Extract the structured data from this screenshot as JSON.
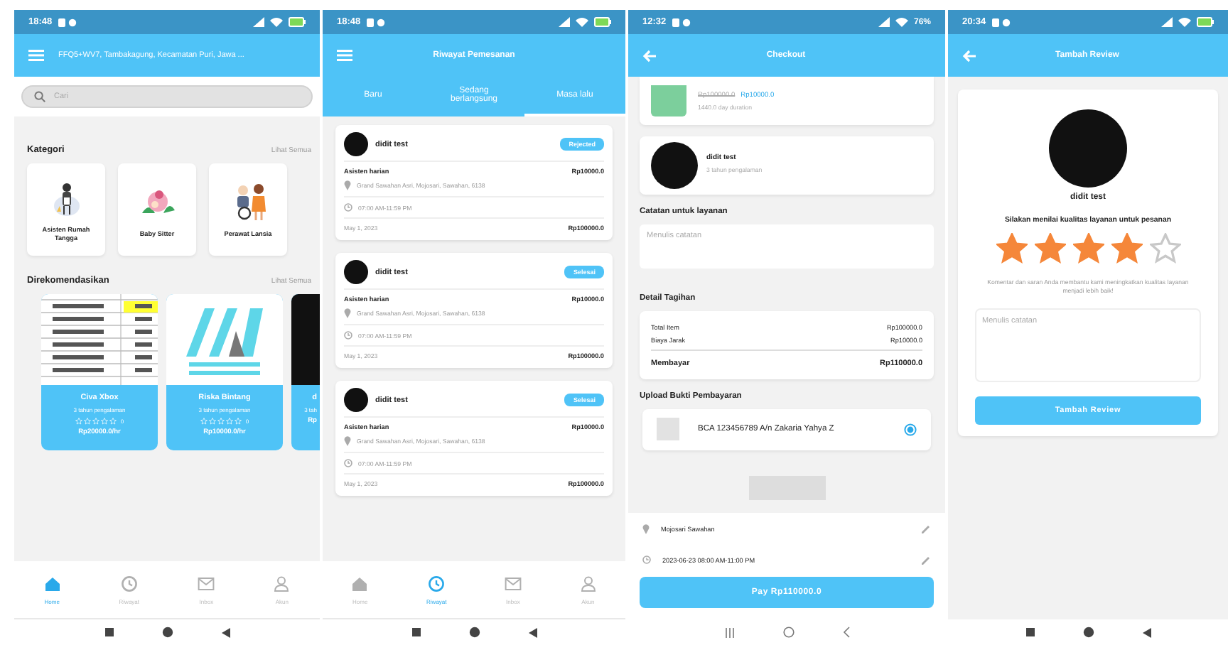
{
  "screens": [
    {
      "kind": "home",
      "system_nav": {
        "kind": "stock"
      },
      "status_bar": {
        "time": "18:48"
      },
      "location": "FFQ5+WV7, Tambakagung, Kecamatan Puri, Jawa ...",
      "search": {
        "placeholder": "Cari"
      },
      "categories": {
        "title": "Kategori",
        "link": "Lihat Semua",
        "items": [
          {
            "kind": "maid",
            "label": "Asisten Rumah Tangga"
          },
          {
            "kind": "baby",
            "label": "Baby Sitter"
          },
          {
            "kind": "elder",
            "label": "Perawat Lansia"
          }
        ]
      },
      "recommended": {
        "title": "Direkomendasikan",
        "link": "Lihat Semua",
        "items": [
          {
            "kind": "spreadsheet",
            "name": "Civa Xbox",
            "experience": "3 tahun pengalaman",
            "stars": 0,
            "rating": "0",
            "price": "Rp20000.0/hr"
          },
          {
            "kind": "logo",
            "name": "Riska Bintang",
            "experience": "3 tahun pengalaman",
            "stars": 0,
            "rating": "0",
            "price": "Rp10000.0/hr"
          },
          {
            "kind": "code",
            "name": "d",
            "experience": "3 tah",
            "price": "Rp"
          }
        ]
      },
      "nav": [
        {
          "kind": "home",
          "label": "Home",
          "selected": true
        },
        {
          "kind": "history",
          "label": "Riwayat",
          "selected": false
        },
        {
          "kind": "mail",
          "label": "Inbox",
          "selected": false
        },
        {
          "kind": "person",
          "label": "Akun",
          "selected": false
        }
      ]
    },
    {
      "kind": "orders",
      "system_nav": {
        "kind": "stock"
      },
      "status_bar": {
        "time": "18:48"
      },
      "title": "Riwayat Pemesanan",
      "tabs": [
        {
          "label": "Baru",
          "selected": false
        },
        {
          "label": "Sedang berlangsung",
          "selected": false
        },
        {
          "label": "Masa lalu",
          "selected": true
        }
      ],
      "orders": [
        {
          "name": "didit test",
          "status": "Rejected",
          "service": "Asisten harian",
          "price": "Rp10000.0",
          "address": "Grand Sawahan Asri, Mojosari, Sawahan, 6138",
          "time": "07:00 AM-11:59 PM",
          "date": "May 1, 2023",
          "total": "Rp100000.0"
        },
        {
          "name": "didit test",
          "status": "Selesai",
          "service": "Asisten harian",
          "price": "Rp10000.0",
          "address": "Grand Sawahan Asri, Mojosari, Sawahan, 6138",
          "time": "07:00 AM-11:59 PM",
          "date": "May 1, 2023",
          "total": "Rp100000.0"
        },
        {
          "name": "didit test",
          "status": "Selesai",
          "service": "Asisten harian",
          "price": "Rp10000.0",
          "address": "Grand Sawahan Asri, Mojosari, Sawahan, 6138",
          "time": "07:00 AM-11:59 PM",
          "date": "May 1, 2023",
          "total": "Rp100000.0"
        }
      ],
      "nav": [
        {
          "kind": "home",
          "label": "Home",
          "selected": false
        },
        {
          "kind": "history",
          "label": "Riwayat",
          "selected": true
        },
        {
          "kind": "mail",
          "label": "Inbox",
          "selected": false
        },
        {
          "kind": "person",
          "label": "Akun",
          "selected": false
        }
      ]
    },
    {
      "kind": "checkout",
      "system_nav": {
        "kind": "samsung"
      },
      "status_bar": {
        "time": "12:32",
        "battery": "76%"
      },
      "title": "Checkout",
      "product": {
        "old_price": "Rp100000.0",
        "price": "Rp10000.0",
        "duration": "1440.0 day duration"
      },
      "worker": {
        "name": "didit test",
        "experience": "3 tahun pengalaman"
      },
      "notes": {
        "label": "Catatan untuk layanan",
        "placeholder": "Menulis catatan"
      },
      "bill": {
        "label": "Detail Tagihan",
        "rows": [
          {
            "label": "Total Item",
            "value": "Rp100000.0"
          },
          {
            "label": "Biaya Jarak",
            "value": "Rp10000.0"
          }
        ],
        "total": {
          "label": "Membayar",
          "value": "Rp110000.0"
        }
      },
      "upload": {
        "label": "Upload Bukti Pembayaran",
        "options": [
          {
            "label": "BCA 123456789 A/n Zakaria Yahya Z",
            "selected": true
          }
        ]
      },
      "address": "Mojosari Sawahan",
      "schedule": "2023-06-23 08:00 AM-11:00 PM",
      "pay_button": "Pay Rp110000.0"
    },
    {
      "kind": "review",
      "system_nav": {
        "kind": "stock"
      },
      "status_bar": {
        "time": "20:34"
      },
      "title": "Tambah Review",
      "review": {
        "name": "didit test",
        "prompt": "Silakan menilai kualitas layanan untuk pesanan",
        "stars": 4,
        "hint": "Komentar dan saran Anda membantu kami meningkatkan kualitas layanan menjadi lebih baik!",
        "placeholder": "Menulis catatan",
        "button": "Tambah Review"
      }
    }
  ]
}
